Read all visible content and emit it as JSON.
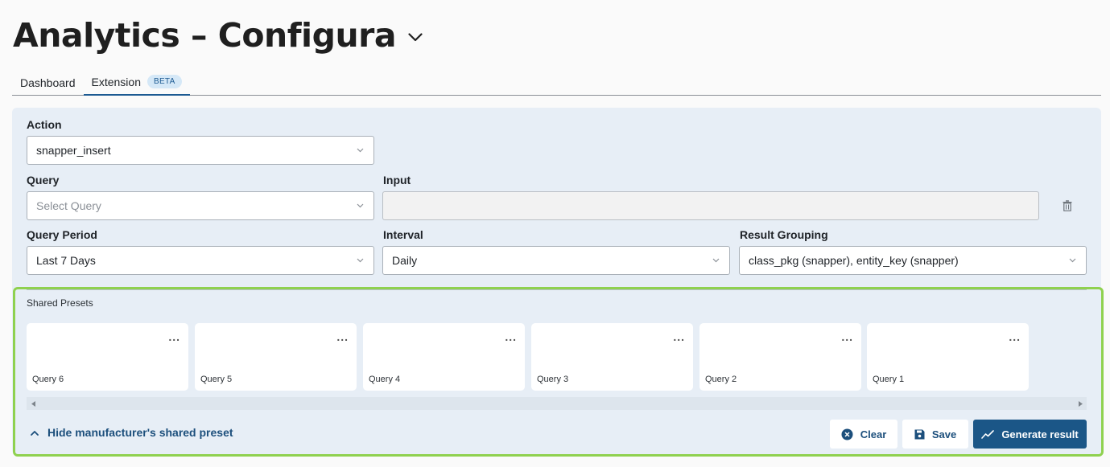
{
  "header": {
    "title": "Analytics – Configura",
    "title_menu_icon": "chevron-down-icon"
  },
  "tabs": [
    {
      "label": "Dashboard",
      "active": false
    },
    {
      "label": "Extension",
      "active": true,
      "badge": "BETA"
    }
  ],
  "form": {
    "action": {
      "label": "Action",
      "value": "snapper_insert"
    },
    "query": {
      "label": "Query",
      "placeholder": "Select Query"
    },
    "input": {
      "label": "Input",
      "value": ""
    },
    "delete_icon": "trash-icon",
    "query_period": {
      "label": "Query Period",
      "value": "Last 7 Days"
    },
    "interval": {
      "label": "Interval",
      "value": "Daily"
    },
    "result_grouping": {
      "label": "Result Grouping",
      "value": "class_pkg (snapper), entity_key (snapper)"
    }
  },
  "presets": {
    "label": "Shared Presets",
    "more_icon": "...",
    "cards": [
      {
        "label": "Query 6"
      },
      {
        "label": "Query 5"
      },
      {
        "label": "Query 4"
      },
      {
        "label": "Query 3"
      },
      {
        "label": "Query 2"
      },
      {
        "label": "Query 1"
      }
    ],
    "hide_link": "Hide manufacturer's shared preset"
  },
  "actions": {
    "clear": "Clear",
    "save": "Save",
    "generate": "Generate result"
  },
  "colors": {
    "accent": "#1b5687",
    "panel_bg": "#e7eef6",
    "highlight": "#8fd14f",
    "badge_bg": "#d5e8f7"
  }
}
